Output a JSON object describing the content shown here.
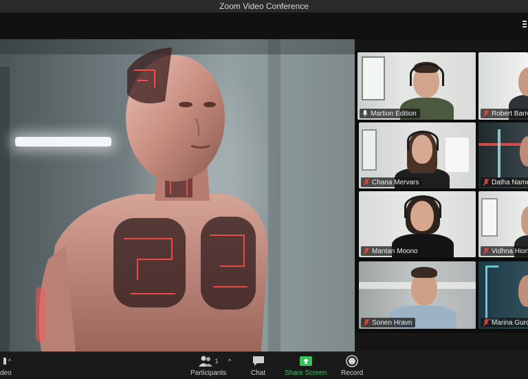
{
  "window": {
    "title": "Zoom Video Conference"
  },
  "participants": [
    {
      "name": "Martion Edition",
      "muted": false,
      "active": true
    },
    {
      "name": "Robert Barre",
      "muted": true,
      "active": false
    },
    {
      "name": "Chana Mervars",
      "muted": true,
      "active": false
    },
    {
      "name": "Datha Name",
      "muted": true,
      "active": false
    },
    {
      "name": "Mantan Moono",
      "muted": true,
      "active": false
    },
    {
      "name": "Vidhna Hion",
      "muted": true,
      "active": false
    },
    {
      "name": "Sonen Hravn",
      "muted": true,
      "active": false
    },
    {
      "name": "Marina Gurc",
      "muted": true,
      "active": false
    }
  ],
  "toolbar": {
    "video_label": "deo",
    "participants_label": "Participants",
    "participants_count": "1",
    "chat_label": "Chat",
    "share_label": "Share Screen",
    "record_label": "Record"
  },
  "colors": {
    "active_speaker_border": "#d7e37a",
    "share_green": "#38c25a",
    "muted_red": "#e0433a"
  }
}
